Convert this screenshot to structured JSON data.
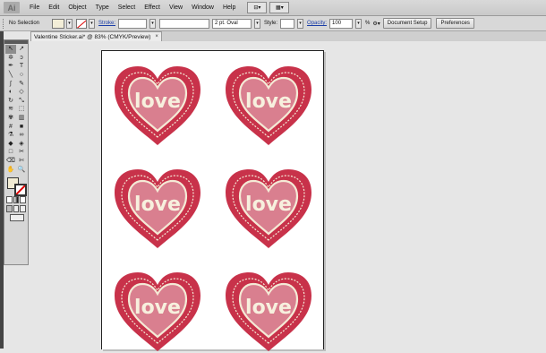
{
  "app": {
    "logo": "Ai"
  },
  "menu": [
    "File",
    "Edit",
    "Object",
    "Type",
    "Select",
    "Effect",
    "View",
    "Window",
    "Help"
  ],
  "menubar_tools": [
    {
      "icon": "bridge-icon",
      "label": "⊟▾"
    },
    {
      "icon": "arrange-documents-icon",
      "label": "▦▾"
    }
  ],
  "options_bar": {
    "selection": "No Selection",
    "stroke_label": "Stroke:",
    "stroke_weight": "",
    "brush": "2 pt. Oval",
    "style_label": "Style:",
    "opacity_label": "Opacity:",
    "opacity_value": "100",
    "opacity_unit": "%",
    "document_setup": "Document Setup",
    "preferences": "Preferences",
    "fill_color": "#f3eed8"
  },
  "document_tab": {
    "title": "Valentine Sticker.ai* @ 83% (CMYK/Preview)",
    "close": "×"
  },
  "tools": [
    "selection-tool",
    "direct-selection-tool",
    "magic-wand-tool",
    "lasso-tool",
    "pen-tool",
    "type-tool",
    "line-tool",
    "ellipse-tool",
    "paintbrush-tool",
    "pencil-tool",
    "blob-brush-tool",
    "eraser-tool",
    "rotate-tool",
    "scale-tool",
    "warp-tool",
    "free-transform-tool",
    "symbol-sprayer-tool",
    "column-graph-tool",
    "mesh-tool",
    "gradient-tool",
    "eyedropper-tool",
    "blend-tool",
    "live-paint-bucket-tool",
    "live-paint-selection-tool",
    "artboard-tool",
    "slice-tool",
    "eraser-tool-2",
    "scissors-tool",
    "hand-tool",
    "zoom-tool"
  ],
  "tool_glyphs": [
    "↖",
    "↗",
    "✲",
    "ↄ",
    "✒",
    "T",
    "╲",
    "○",
    "∫",
    "✎",
    "◐",
    "◇",
    "↻",
    "⤡",
    "≋",
    "⬚",
    "✾",
    "▥",
    "#",
    "■",
    "⚗",
    "∞",
    "◆",
    "◈",
    "□",
    "✂",
    "⌫",
    "✄",
    "✋",
    "🔍"
  ],
  "stickers": {
    "text": "love",
    "outer_color": "#c8324a",
    "inner_color": "#d97f8f",
    "border_color": "#f4ead6",
    "text_color": "#f7f0de",
    "count": 6
  }
}
